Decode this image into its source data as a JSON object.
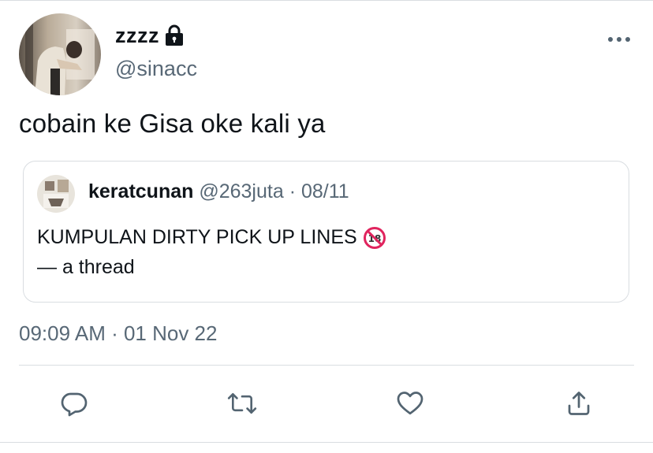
{
  "tweet": {
    "display_name": "zzzz",
    "handle": "@sinacc",
    "text": "cobain ke Gisa oke kali ya",
    "timestamp": "09:09 AM · 01 Nov 22"
  },
  "quoted_tweet": {
    "display_name": "keratcunan",
    "handle": "@263juta",
    "separator": "·",
    "date": "08/11",
    "line1": "KUMPULAN DIRTY PICK UP LINES",
    "line2": "— a thread"
  },
  "icons": {
    "lock": "lock-icon",
    "more": "more-horizontal-icon",
    "no_under_18": "no-one-under-eighteen-icon",
    "reply": "reply-icon",
    "retweet": "retweet-icon",
    "like": "heart-icon",
    "share": "share-icon"
  },
  "colors": {
    "text_primary": "#0f1419",
    "text_secondary": "#586876",
    "border": "#d9dde1",
    "icon": "#536471",
    "badge_red": "#e0245e"
  }
}
